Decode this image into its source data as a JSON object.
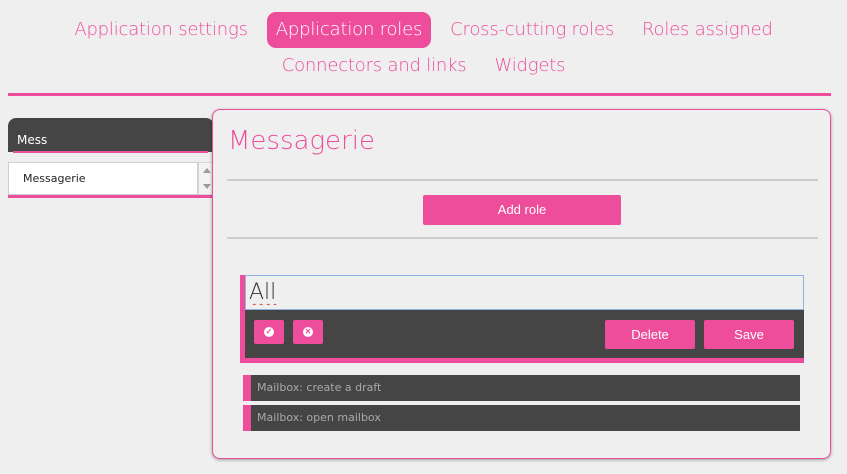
{
  "tabs": {
    "row1": [
      "Application settings",
      "Application roles",
      "Cross-cutting roles",
      "Roles assigned"
    ],
    "row2": [
      "Connectors and links",
      "Widgets"
    ],
    "active": "Application roles"
  },
  "app_search": {
    "value": "Mess"
  },
  "app_list": {
    "items": [
      "Messagerie"
    ]
  },
  "card": {
    "title": "Messagerie",
    "add_role_label": "Add role"
  },
  "role_editor": {
    "name_value": "All",
    "select_all_icon": "check-circle-icon",
    "deselect_all_icon": "cross-circle-icon",
    "delete_label": "Delete",
    "save_label": "Save"
  },
  "actions": [
    "Mailbox: create a draft",
    "Mailbox: open mailbox"
  ],
  "colors": {
    "accent": "#ee4d9c",
    "dark": "#454545",
    "background": "#efefef"
  }
}
